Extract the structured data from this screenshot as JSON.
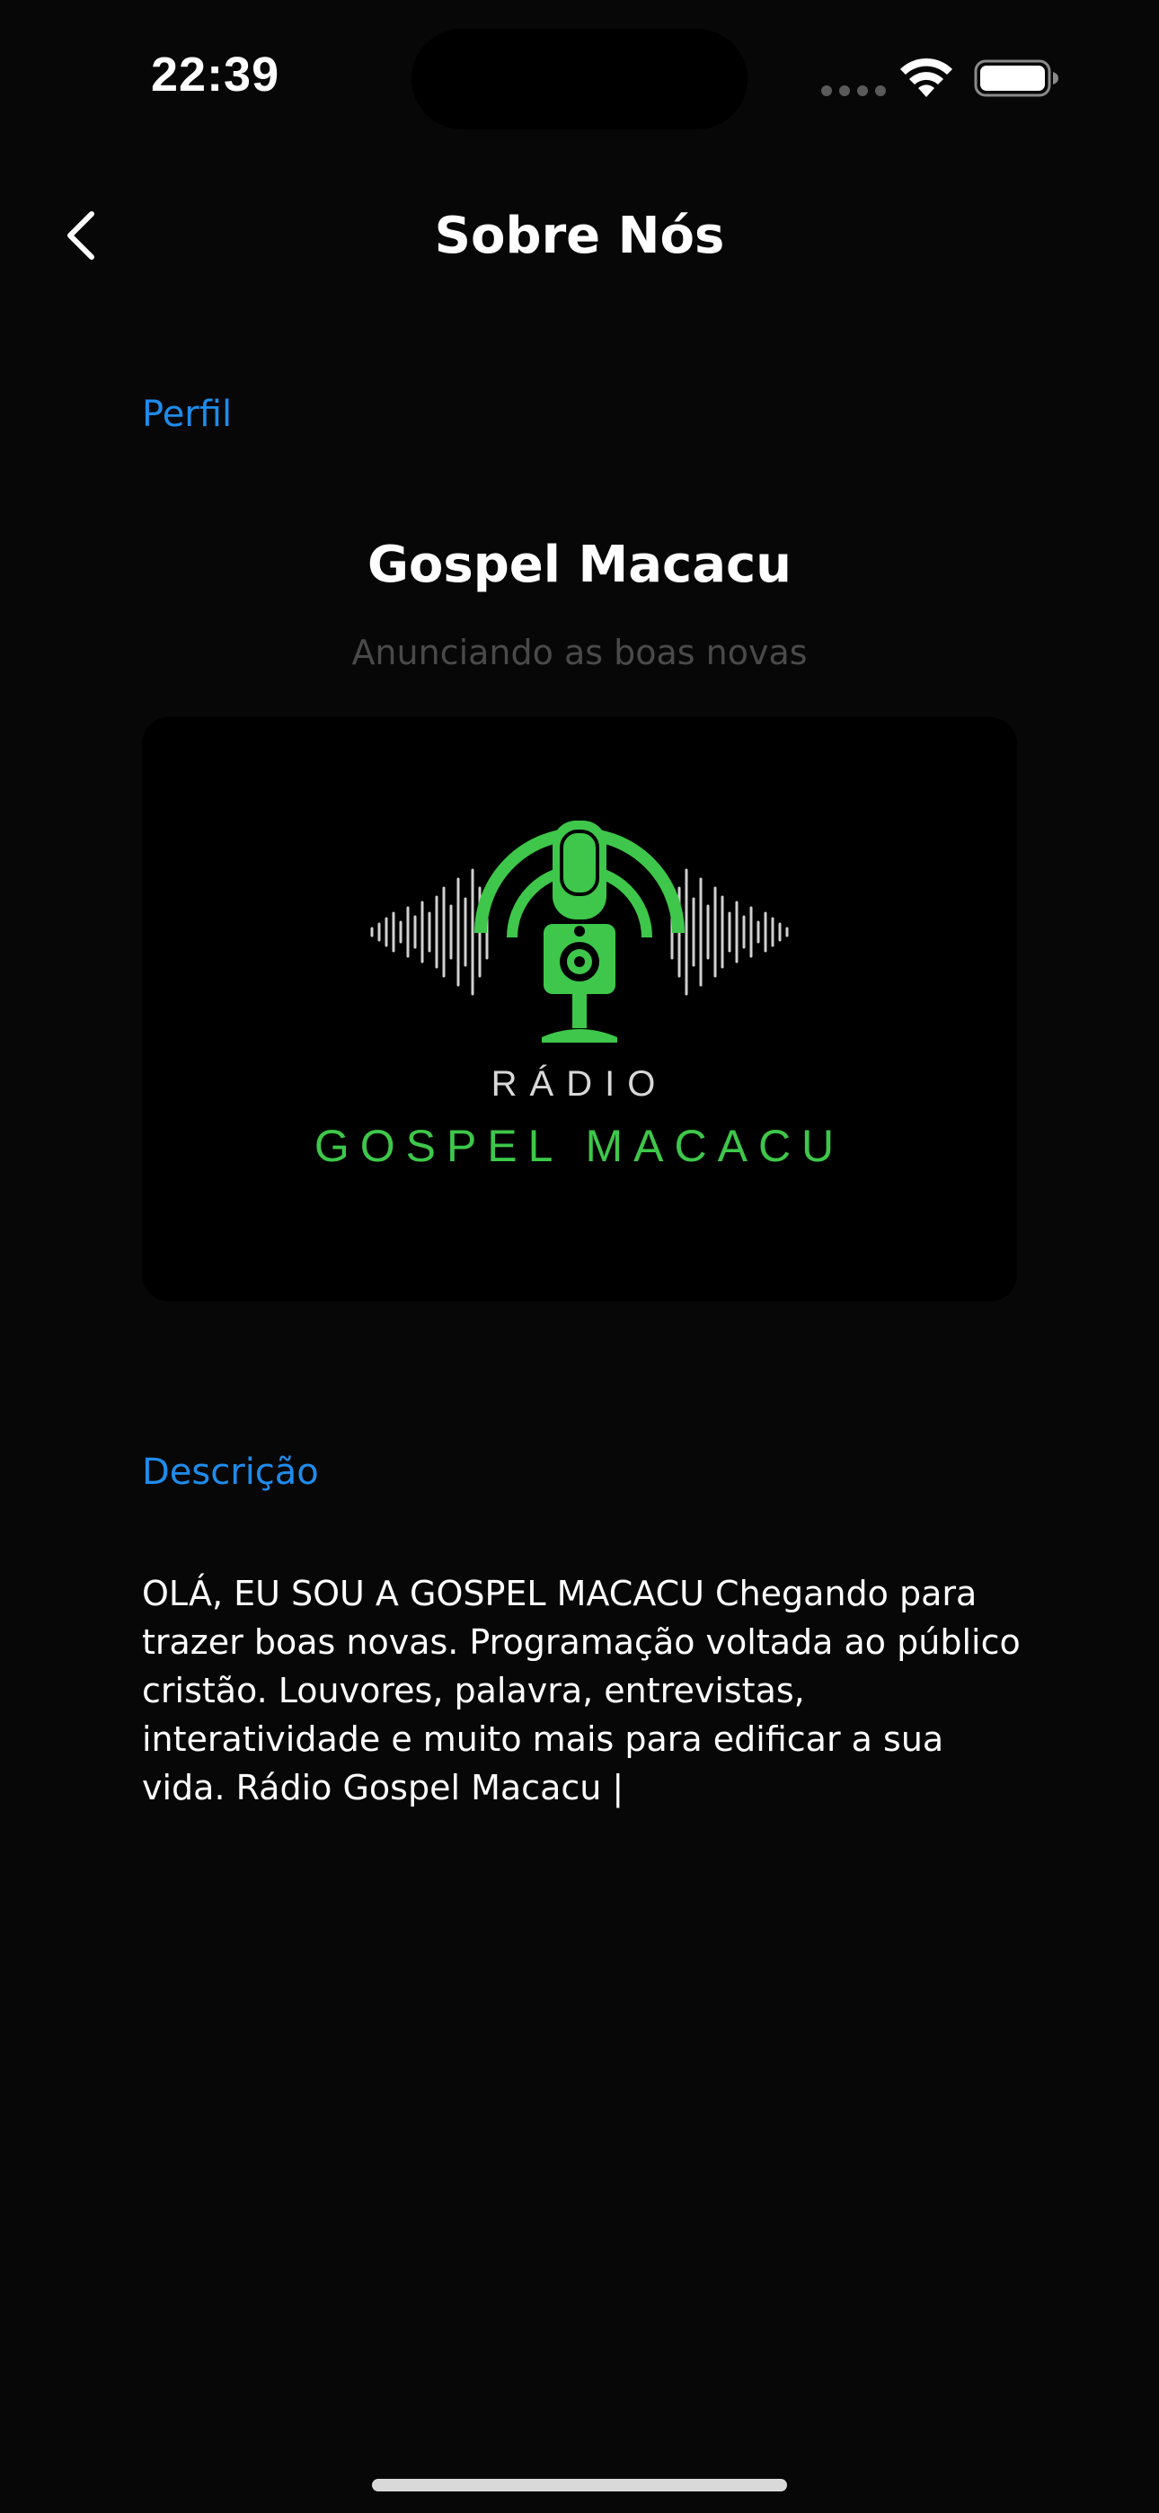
{
  "status_bar": {
    "time": "22:39",
    "icons": [
      "cellular-signal-icon",
      "wifi-icon",
      "battery-icon"
    ]
  },
  "nav": {
    "back_icon": "chevron-left-icon",
    "title": "Sobre Nós"
  },
  "profile": {
    "section_label": "Perfil",
    "name": "Gospel Macacu",
    "tagline": "Anunciando as boas novas",
    "logo": {
      "radio_text": "RÁDIO",
      "brand_text": "GOSPEL MACACU",
      "icon": "microphone-soundwave-logo"
    }
  },
  "description": {
    "section_label": "Descrição",
    "text": "OLÁ, EU SOU A GOSPEL MACACU Chegando para trazer boas novas. Programação voltada ao público cristão. Louvores, palavra, entrevistas, interatividade e muito mais para edificar a sua vida. Rádio Gospel Macacu |"
  },
  "colors": {
    "background": "#070707",
    "accent_blue": "#1f8ceb",
    "brand_green": "#3ec74a",
    "tagline_gray": "#4a4a4a"
  }
}
